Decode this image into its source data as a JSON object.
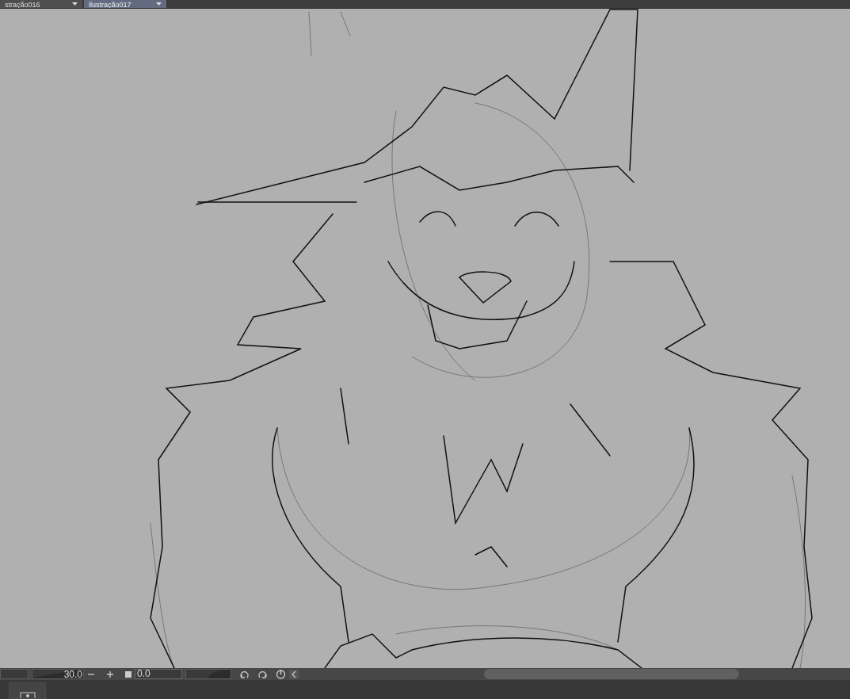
{
  "tabs": [
    {
      "label": "stração016",
      "selected": false
    },
    {
      "label": "ilustração017",
      "selected": true
    }
  ],
  "zoom": {
    "value": "30.0"
  },
  "rotation": {
    "value": "0.0",
    "level": 0.5
  }
}
